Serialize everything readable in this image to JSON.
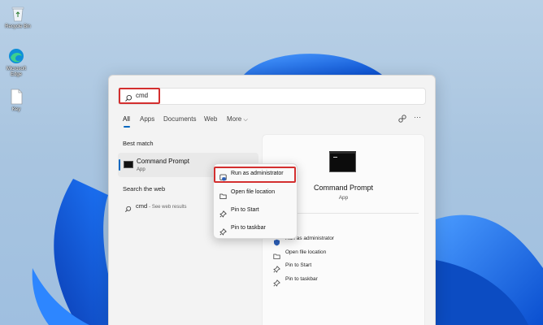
{
  "desktop": {
    "icons": [
      {
        "label": "Recycle Bin",
        "icon": "recycle-bin-icon"
      },
      {
        "label": "Microsoft Edge",
        "icon": "edge-icon"
      },
      {
        "label": "Key",
        "icon": "document-icon"
      }
    ]
  },
  "search": {
    "query": "cmd",
    "icon": "search-icon"
  },
  "tabs": [
    {
      "label": "All",
      "active": true
    },
    {
      "label": "Apps"
    },
    {
      "label": "Documents"
    },
    {
      "label": "Web"
    },
    {
      "label": "More",
      "icon": "chevron-down-icon"
    }
  ],
  "top_actions": [
    {
      "icon": "share-link-icon"
    },
    {
      "icon": "more-dots-icon",
      "label": "···"
    }
  ],
  "best_match": {
    "heading": "Best match",
    "name": "Command Prompt",
    "type": "App",
    "icon": "command-prompt-icon"
  },
  "web": {
    "heading": "Search the web",
    "query": "cmd",
    "hint": "- See web results",
    "icon": "search-icon"
  },
  "preview": {
    "title": "Command Prompt",
    "subtitle": "App",
    "actions": [
      {
        "label": "Run as administrator",
        "icon": "shield-icon"
      },
      {
        "label": "Open file location",
        "icon": "folder-icon"
      },
      {
        "label": "Pin to Start",
        "icon": "pin-icon"
      },
      {
        "label": "Pin to taskbar",
        "icon": "pin-icon"
      }
    ]
  },
  "context_menu": {
    "items": [
      {
        "label": "Run as administrator",
        "icon": "shield-icon",
        "highlighted": true
      },
      {
        "label": "Open file location",
        "icon": "folder-icon"
      },
      {
        "label": "Pin to Start",
        "icon": "pin-icon"
      },
      {
        "label": "Pin to taskbar",
        "icon": "pin-icon"
      }
    ]
  },
  "colors": {
    "accent": "#0067c0",
    "highlight_border": "#d32f2f",
    "wallpaper_blue": "#1a6fe6"
  }
}
